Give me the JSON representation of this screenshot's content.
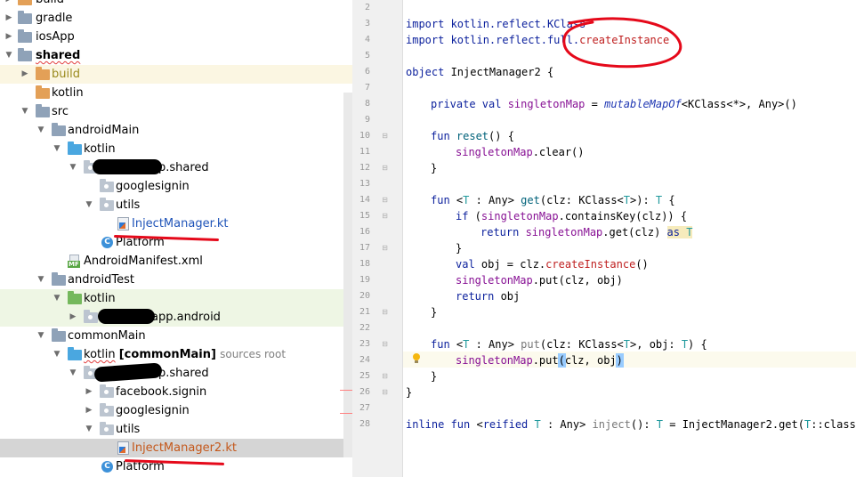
{
  "tree": {
    "items": [
      {
        "label": "build",
        "suffix": ""
      },
      {
        "label": "gradle",
        "suffix": ""
      },
      {
        "label": "iosApp",
        "suffix": ""
      },
      {
        "label": "shared",
        "suffix": ""
      },
      {
        "label": "build",
        "suffix": ""
      },
      {
        "label": "kotlin",
        "suffix": ""
      },
      {
        "label": "src",
        "suffix": ""
      },
      {
        "label": "androidMain",
        "suffix": ""
      },
      {
        "label": "kotlin",
        "suffix": ""
      },
      {
        "label": "p.shared",
        "suffix": ""
      },
      {
        "label": "googlesignin",
        "suffix": ""
      },
      {
        "label": "utils",
        "suffix": ""
      },
      {
        "label": "InjectManager.kt",
        "suffix": ""
      },
      {
        "label": "Platform",
        "suffix": ""
      },
      {
        "label": "AndroidManifest.xml",
        "suffix": ""
      },
      {
        "label": "androidTest",
        "suffix": ""
      },
      {
        "label": "kotlin",
        "suffix": ""
      },
      {
        "label": "app.android",
        "suffix": ""
      },
      {
        "label": "commonMain",
        "suffix": ""
      },
      {
        "label": "kotlin",
        "bold": "[commonMain]",
        "suffix": "sources root"
      },
      {
        "label": "p.shared",
        "suffix": ""
      },
      {
        "label": "facebook.signin",
        "suffix": ""
      },
      {
        "label": "googlesignin",
        "suffix": ""
      },
      {
        "label": "utils",
        "suffix": ""
      },
      {
        "label": "InjectManager2.kt",
        "suffix": ""
      },
      {
        "label": "Platform",
        "suffix": ""
      }
    ]
  },
  "editor": {
    "line_numbers": [
      "2",
      "3",
      "4",
      "5",
      "6",
      "7",
      "8",
      "9",
      "10",
      "11",
      "12",
      "13",
      "14",
      "15",
      "16",
      "17",
      "18",
      "19",
      "20",
      "21",
      "22",
      "23",
      "24",
      "25",
      "26",
      "27",
      "28"
    ],
    "code": {
      "l3a": "import kotlin.reflect.KClass",
      "l4a": "import kotlin.reflect.full.",
      "l4b": "createInstance",
      "l6a": "object",
      "l6b": " InjectManager2 {",
      "l8a": "private val",
      "l8b": " singletonMap",
      "l8c": " = ",
      "l8d": "mutableMapOf",
      "l8e": "<KClass<*>, Any>()",
      "l10a": "fun",
      "l10b": " reset",
      "l10c": "() {",
      "l11a": "singletonMap",
      "l11b": ".clear()",
      "l12a": "}",
      "l14a": "fun",
      "l14b": " <",
      "l14c": "T",
      "l14d": " : Any> ",
      "l14e": "get",
      "l14f": "(clz: KClass<",
      "l14g": "T",
      "l14h": ">): ",
      "l14i": "T",
      "l14j": " {",
      "l15a": "if",
      "l15b": " (",
      "l15c": "singletonMap",
      "l15d": ".containsKey(clz)) {",
      "l16a": "return",
      "l16b": " singletonMap",
      "l16c": ".get(clz) ",
      "l16d": "as",
      "l16e": " T",
      "l17a": "}",
      "l18a": "val",
      "l18b": " obj = clz.",
      "l18c": "createInstance",
      "l18d": "()",
      "l19a": "singletonMap",
      "l19b": ".put(clz, obj)",
      "l20a": "return",
      "l20b": " obj",
      "l21a": "}",
      "l23a": "fun",
      "l23b": " <",
      "l23c": "T",
      "l23d": " : Any> ",
      "l23e": "put",
      "l23f": "(clz: KClass<",
      "l23g": "T",
      "l23h": ">, obj: ",
      "l23i": "T",
      "l23j": ") {",
      "l24a": "singletonMap",
      "l24b": ".put",
      "l24c": "(",
      "l24d": "clz, obj",
      "l24e": ")",
      "l25a": "}",
      "l26a": "}",
      "l28a": "inline fun",
      "l28b": " <",
      "l28c": "reified",
      "l28d": " T",
      "l28e": " : Any> ",
      "l28f": "inject",
      "l28g": "(): ",
      "l28h": "T",
      "l28i": " = InjectManager2.get(",
      "l28j": "T",
      "l28k": "::class)"
    }
  },
  "colors": {
    "keyword": "#0a1f9c",
    "function": "#00627a",
    "field": "#871094",
    "annotation_red": "#e5091a",
    "selection": "#d5d5d5"
  }
}
